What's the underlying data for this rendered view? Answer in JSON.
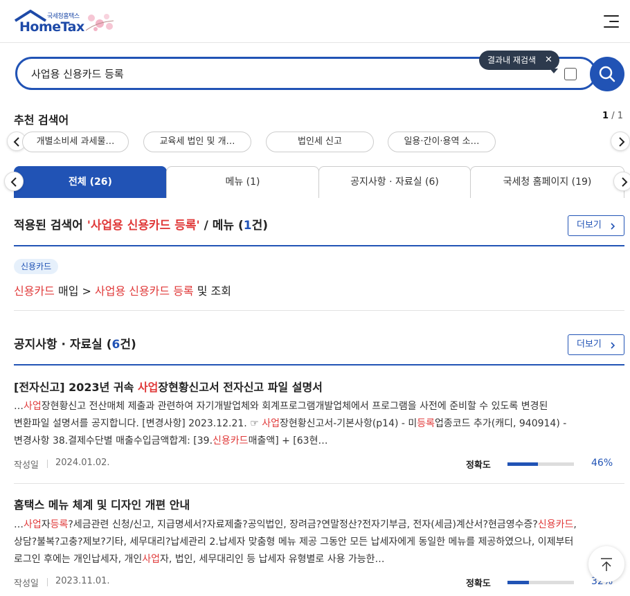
{
  "header": {
    "logo_small": "국세청홈택스",
    "logo_main": "HomeTax"
  },
  "search": {
    "value": "사업용 신용카드 등록",
    "tooltip": "결과내 재검색"
  },
  "recommend": {
    "title": "추천 검색어",
    "page_current": "1",
    "page_total": " / 1",
    "chips": [
      "개별소비세 과세물…",
      "교육세 법인 및 개…",
      "법인세 신고",
      "일용·간이·용역 소…"
    ]
  },
  "tabs": [
    {
      "label": "전체 (26)",
      "active": true
    },
    {
      "label": "메뉴 (1)",
      "active": false
    },
    {
      "label": "공지사항 · 자료실 (6)",
      "active": false
    },
    {
      "label": "국세청 홈페이지 (19)",
      "active": false
    }
  ],
  "menu_section": {
    "prefix": "적용된 검색어 ",
    "query": "'사업용 신용카드 등록'",
    "middle": " / 메뉴 (",
    "count": "1",
    "suffix": "건)",
    "more": "더보기",
    "tag": "신용카드",
    "path_hl1": "신용카드",
    "path_text1": " 매입 > ",
    "path_hl2": "사업용 신용카드 등록",
    "path_text2": " 및 조회"
  },
  "notice_section": {
    "prefix": "공지사항 · 자료실 (",
    "count": "6",
    "suffix": "건)",
    "more": "더보기"
  },
  "posts": [
    {
      "title_a": "[전자신고] 2023년 귀속 ",
      "title_hl": "사업",
      "title_b": "장현황신고서 전자신고 파일 설명서",
      "line1": [
        "…",
        "사업",
        "장현황신고 전산매체 제출과 관련하여 자기개발업체와 회계프로그램개발업체에서 프로그램을 사전에 준비할 수 있도록 변경된"
      ],
      "line2": [
        "변환파일 설명서를 공지합니다. [변경사항] 2023.12.21. ☞ ",
        "사업",
        "장현황신고서-기본사항(p14) - 미",
        "등록",
        "업종코드 추가(캐디, 940914) -"
      ],
      "line3": [
        "변경사항 38.결제수단별 매출수입금액합계: [39.",
        "신용카드",
        "매출액] + [63현…"
      ],
      "date_label": "작성일",
      "date": "2024.01.02.",
      "accuracy_label": "정확도",
      "accuracy": 46,
      "accuracy_text": "46%"
    },
    {
      "title": "홈택스 메뉴 체계 및 디자인 개편 안내",
      "line1": [
        "…",
        "사업",
        "자",
        "등록",
        "?세금관련 신청/신고, 지급명세서?자료제출?공익법인, 장려금?연말정산?전자기부금, 전자(세금)계산서?현금영수증?",
        "신용카드",
        ","
      ],
      "line2": "상담?불복?고충?제보?기타, 세무대리?납세관리 2.납세자 맞춤형 메뉴 제공 그동안 모든 납세자에게 동일한 메뉴를 제공하였으나, 이제부터",
      "line3": [
        "로그인 후에는 개인납세자, 개인",
        "사업",
        "자, 법인, 세무대리인 등 납세자 유형별로 사용 가능한…"
      ],
      "date_label": "작성일",
      "date": "2023.11.01.",
      "accuracy_label": "정확도",
      "accuracy": 32,
      "accuracy_text": "32%"
    }
  ],
  "colors": {
    "primary": "#2153b5",
    "highlight": "#e03a3a",
    "tooltip_bg": "#2d3a4d"
  },
  "icons": {
    "search": "search-icon",
    "menu": "hamburger-menu-icon",
    "prev": "chevron-left-icon",
    "next": "chevron-right-icon",
    "top": "arrow-up-icon",
    "close": "close-icon"
  }
}
